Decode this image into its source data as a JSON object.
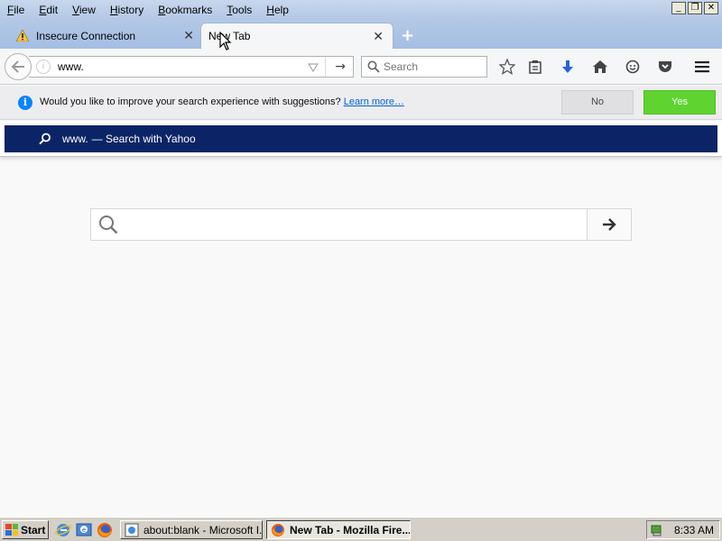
{
  "menu": {
    "items": [
      {
        "underline": "F",
        "rest": "ile"
      },
      {
        "underline": "E",
        "rest": "dit"
      },
      {
        "underline": "V",
        "rest": "iew"
      },
      {
        "underline": "H",
        "rest": "istory"
      },
      {
        "underline": "B",
        "rest": "ookmarks"
      },
      {
        "underline": "T",
        "rest": "ools"
      },
      {
        "underline": "H",
        "rest": "elp"
      }
    ]
  },
  "tabs": [
    {
      "label": "Insecure Connection",
      "close": "✕"
    },
    {
      "label": "New Tab",
      "close": "✕"
    }
  ],
  "new_tab_button": "+",
  "urlbar": {
    "value": "www."
  },
  "searchbar": {
    "placeholder": "Search"
  },
  "notification": {
    "message": "Would you like to improve your search experience with suggestions? ",
    "link": "Learn more…",
    "no_label": "No",
    "yes_label": "Yes"
  },
  "suggestion": {
    "query": "www.",
    "engine_text": "— Search with Yahoo"
  },
  "taskbar": {
    "start_label": "Start",
    "tasks": [
      {
        "label": "about:blank - Microsoft I..."
      },
      {
        "label": "New Tab - Mozilla Fire..."
      }
    ],
    "clock": "8:33 AM"
  },
  "colors": {
    "accent_blue": "#0a84ff",
    "suggest_highlight": "#0b2466",
    "yes_green": "#5fd32f"
  }
}
